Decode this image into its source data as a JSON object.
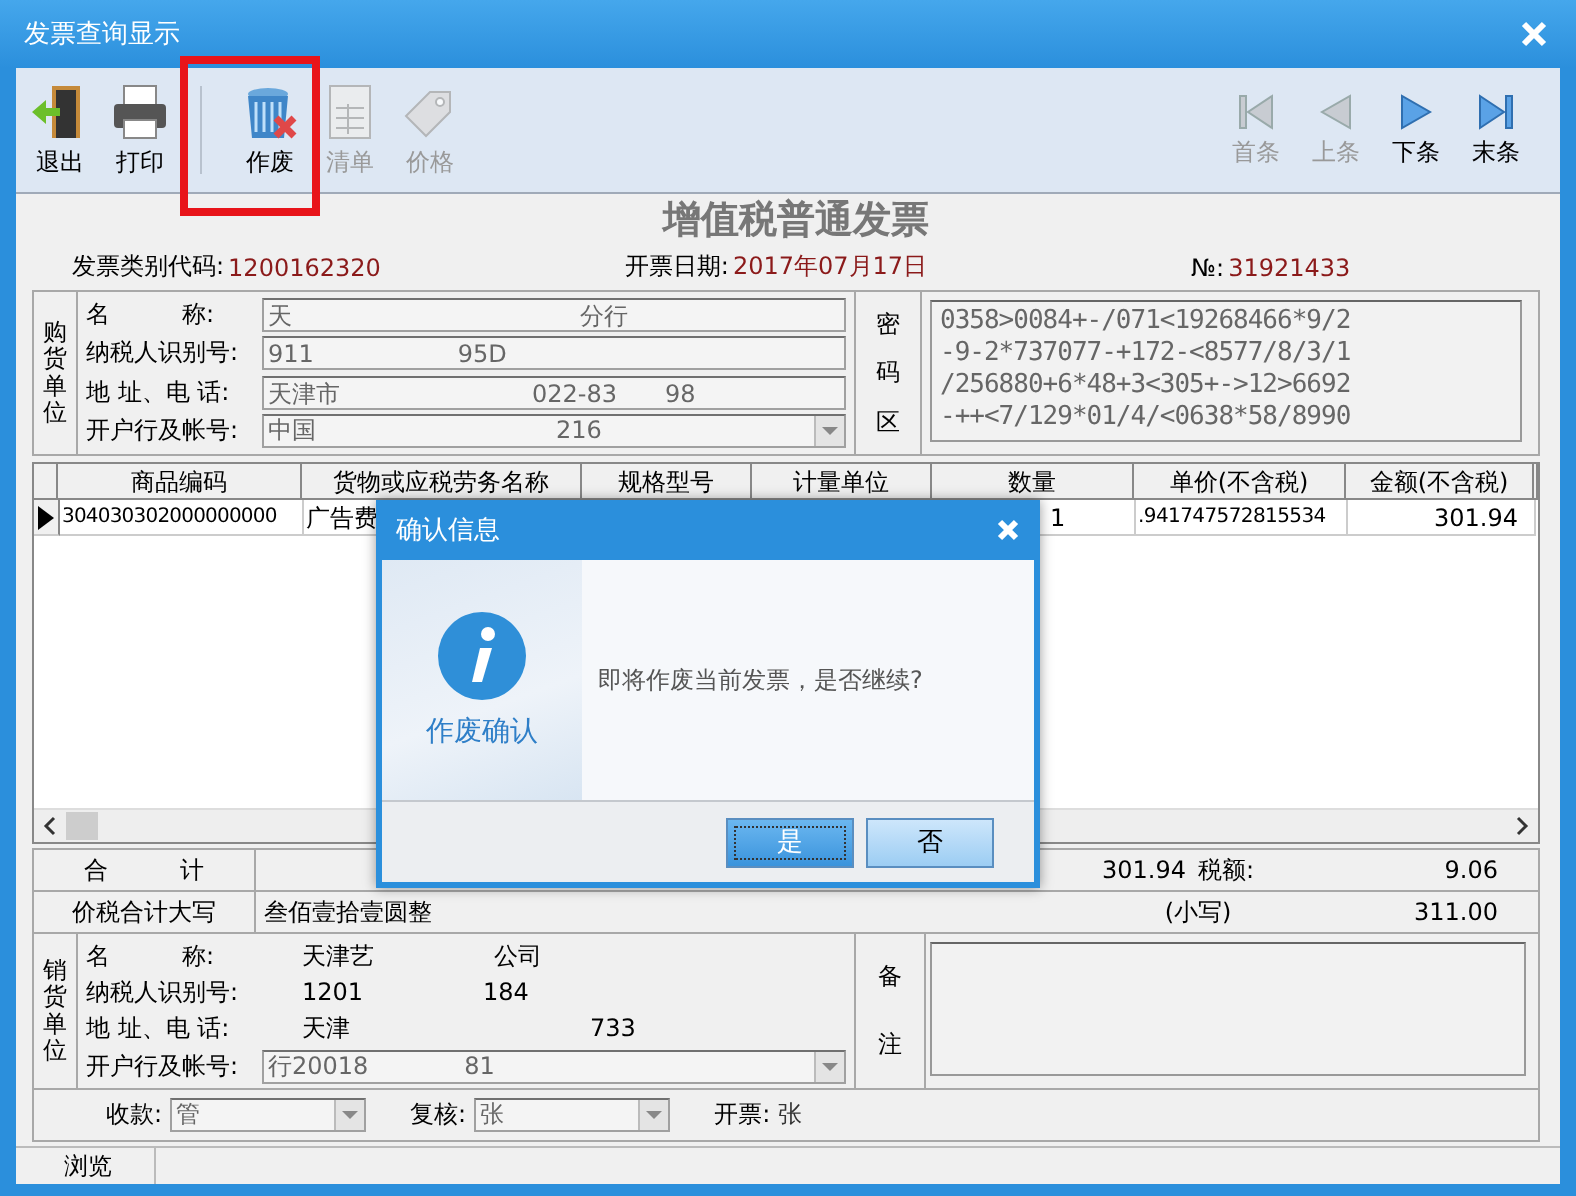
{
  "window": {
    "title": "发票查询显示"
  },
  "toolbar": {
    "left": [
      {
        "label": "退出",
        "kind": "exit",
        "disabled": false
      },
      {
        "label": "打印",
        "kind": "print",
        "disabled": false
      },
      {
        "label": "作废",
        "kind": "void",
        "disabled": false
      },
      {
        "label": "清单",
        "kind": "list",
        "disabled": true
      },
      {
        "label": "价格",
        "kind": "price",
        "disabled": true
      }
    ],
    "right": [
      {
        "label": "首条",
        "kind": "first",
        "disabled": true
      },
      {
        "label": "上条",
        "kind": "prev",
        "disabled": true
      },
      {
        "label": "下条",
        "kind": "next",
        "disabled": false
      },
      {
        "label": "末条",
        "kind": "last",
        "disabled": false
      }
    ]
  },
  "invoice": {
    "title": "增值税普通发票",
    "code_label": "发票类别代码:",
    "code": "1200162320",
    "date_label": "开票日期:",
    "date": "2017年07月17日",
    "number_label": "№:",
    "number": "31921433"
  },
  "buyer": {
    "side_label": "购货单位",
    "fields": [
      {
        "label": "名　　　称:",
        "value": "天　　　　　　　　　　　　分行",
        "kind": "field"
      },
      {
        "label": "纳税人识别号:",
        "value": "911　　　　　　95D",
        "kind": "field"
      },
      {
        "label": "地 址、电 话:",
        "value": "天津市　　　　　　　　022-83　　98",
        "kind": "field"
      },
      {
        "label": "开户行及帐号:",
        "value": "中国　　　　　　　　　　216",
        "kind": "dropdown"
      }
    ],
    "cipher_label": "密码区",
    "cipher_lines": [
      "0358>0084+-/071<19268466*9/2",
      "-9-2*737077-+172-<8577/8/3/1",
      "/256880+6*48+3<305+->12>6692",
      "-++<7/129*01/4/<0638*58/8990"
    ]
  },
  "table": {
    "columns": [
      "商品编码",
      "货物或应税劳务名称",
      "规格型号",
      "计量单位",
      "数量",
      "单价(不含税)",
      "金额(不含税)"
    ],
    "rows": [
      {
        "selected": true,
        "product_code": "304030302000000000",
        "name": "广告费",
        "quantity": "1",
        "unit_price": ".941747572815534",
        "amount": "301.94"
      }
    ]
  },
  "totals": {
    "label": "合　　　计",
    "amount": "301.94",
    "tax_label": "税额:",
    "tax": "9.06",
    "words_label": "价税合计大写",
    "words": "叁佰壹拾壹圆整",
    "small_label": "(小写)",
    "small": "311.00"
  },
  "seller": {
    "side_label": "销货单位",
    "fields": [
      {
        "label": "名　　　称:",
        "value": "天津艺　　　　　公司",
        "kind": "text"
      },
      {
        "label": "纳税人识别号:",
        "value": "1201　　　　　184",
        "kind": "text"
      },
      {
        "label": "地 址、电 话:",
        "value": "天津　　　　　　　　　　733",
        "kind": "text"
      },
      {
        "label": "开户行及帐号:",
        "value": "行20018　　　　81",
        "kind": "dropdown"
      }
    ],
    "remarks_label": "备注"
  },
  "signatures": [
    {
      "label": "收款:",
      "value": "管",
      "kind": "dropdown"
    },
    {
      "label": "复核:",
      "value": "张",
      "kind": "dropdown"
    },
    {
      "label": "开票:",
      "value": "张",
      "kind": "text"
    }
  ],
  "status_bar": [
    "浏览"
  ],
  "dialog": {
    "title": "确认信息",
    "caption": "作废确认",
    "message": "即将作废当前发票，是否继续?",
    "buttons": [
      {
        "label": "是",
        "selected": true
      },
      {
        "label": "否",
        "selected": false
      }
    ]
  }
}
